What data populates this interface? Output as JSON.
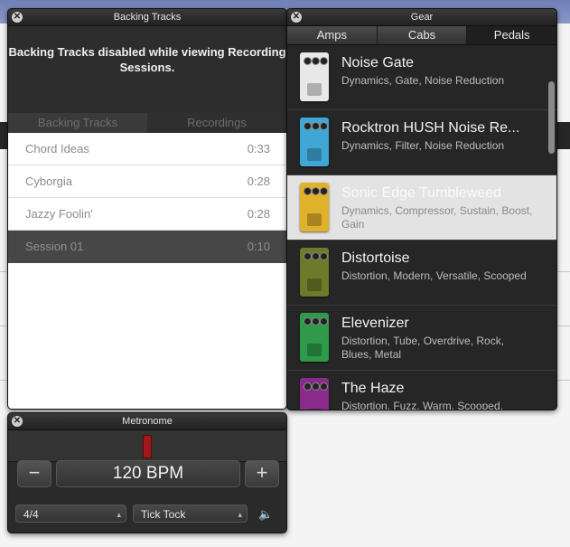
{
  "backing_tracks": {
    "title": "Backing Tracks",
    "message": "Backing Tracks disabled while viewing Recording Sessions.",
    "tabs": [
      {
        "label": "Backing Tracks"
      },
      {
        "label": "Recordings"
      }
    ],
    "rows": [
      {
        "name": "Chord Ideas",
        "duration": "0:33"
      },
      {
        "name": "Cyborgia",
        "duration": "0:28"
      },
      {
        "name": "Jazzy Foolin'",
        "duration": "0:28"
      },
      {
        "name": "Session 01",
        "duration": "0:10"
      }
    ]
  },
  "gear": {
    "title": "Gear",
    "tabs": [
      {
        "label": "Amps"
      },
      {
        "label": "Cabs"
      },
      {
        "label": "Pedals"
      }
    ],
    "items": [
      {
        "name": "Noise Gate",
        "desc": "Dynamics, Gate, Noise Reduction",
        "color": "#e8e8e8"
      },
      {
        "name": "Rocktron HUSH Noise Re...",
        "desc": "Dynamics, Filter, Noise Reduction",
        "color": "#3fa6d6"
      },
      {
        "name": "Sonic Edge Tumbleweed",
        "desc": "Dynamics, Compressor, Sustain, Boost, Gain",
        "color": "#e0b22c"
      },
      {
        "name": "Distortoise",
        "desc": "Distortion, Modern, Versatile, Scooped",
        "color": "#6c7a2a"
      },
      {
        "name": "Elevenizer",
        "desc": "Distortion, Tube, Overdrive, Rock, Blues, Metal",
        "color": "#2e9a4a"
      },
      {
        "name": "The Haze",
        "desc": "Distortion, Fuzz, Warm, Scooped,",
        "color": "#8a2a8a"
      }
    ]
  },
  "metronome": {
    "title": "Metronome",
    "minus": "−",
    "plus": "+",
    "bpm": "120 BPM",
    "time_signature": "4/4",
    "sound": "Tick Tock"
  }
}
